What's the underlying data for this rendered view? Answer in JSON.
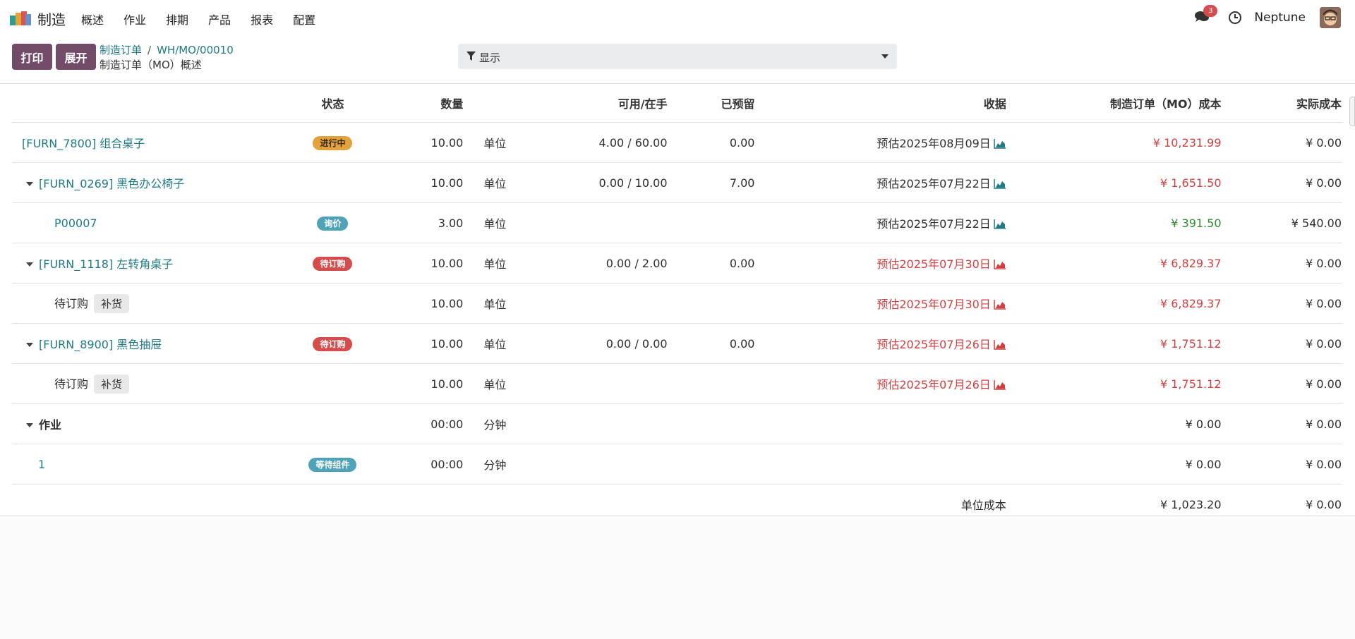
{
  "app": {
    "name": "制造"
  },
  "menu": [
    "概述",
    "作业",
    "排期",
    "产品",
    "报表",
    "配置"
  ],
  "topbar": {
    "chat_count": "3",
    "user": "Neptune"
  },
  "actions": {
    "print": "打印",
    "expand": "展开"
  },
  "breadcrumb": {
    "parent": "制造订单",
    "sep": "/",
    "current": "WH/MO/00010",
    "subtitle": "制造订单（MO）概述"
  },
  "filter": {
    "label": "显示"
  },
  "table": {
    "headers": {
      "status": "状态",
      "qty": "数量",
      "avail": "可用/在手",
      "reserved": "已预留",
      "receipt": "收据",
      "mo_cost": "制造订单（MO）成本",
      "real_cost": "实际成本"
    },
    "rows": [
      {
        "name": "[FURN_7800] 组合桌子",
        "status": "进行中",
        "qty": "10.00",
        "uom": "单位",
        "avail": "4.00 / 60.00",
        "reserved": "0.00",
        "receipt": "预估2025年08月09日",
        "mo_cost": "¥ 10,231.99",
        "real_cost": "¥ 0.00"
      },
      {
        "name": "[FURN_0269] 黑色办公椅子",
        "status": "",
        "qty": "10.00",
        "uom": "单位",
        "avail": "0.00 / 10.00",
        "reserved": "7.00",
        "receipt": "预估2025年07月22日",
        "mo_cost": "¥ 1,651.50",
        "real_cost": "¥ 0.00"
      },
      {
        "name": "P00007",
        "status": "询价",
        "qty": "3.00",
        "uom": "单位",
        "avail": "",
        "reserved": "",
        "receipt": "预估2025年07月22日",
        "mo_cost": "¥ 391.50",
        "real_cost": "¥ 540.00"
      },
      {
        "name": "[FURN_1118] 左转角桌子",
        "status": "待订购",
        "qty": "10.00",
        "uom": "单位",
        "avail": "0.00 / 2.00",
        "reserved": "0.00",
        "receipt": "预估2025年07月30日",
        "mo_cost": "¥ 6,829.37",
        "real_cost": "¥ 0.00"
      },
      {
        "name": "待订购",
        "tag": "补货",
        "status": "",
        "qty": "10.00",
        "uom": "单位",
        "avail": "",
        "reserved": "",
        "receipt": "预估2025年07月30日",
        "mo_cost": "¥ 6,829.37",
        "real_cost": "¥ 0.00"
      },
      {
        "name": "[FURN_8900] 黑色抽屉",
        "status": "待订购",
        "qty": "10.00",
        "uom": "单位",
        "avail": "0.00 / 0.00",
        "reserved": "0.00",
        "receipt": "预估2025年07月26日",
        "mo_cost": "¥ 1,751.12",
        "real_cost": "¥ 0.00"
      },
      {
        "name": "待订购",
        "tag": "补货",
        "status": "",
        "qty": "10.00",
        "uom": "单位",
        "avail": "",
        "reserved": "",
        "receipt": "预估2025年07月26日",
        "mo_cost": "¥ 1,751.12",
        "real_cost": "¥ 0.00"
      },
      {
        "name": "作业",
        "status": "",
        "qty": "00:00",
        "uom": "分钟",
        "avail": "",
        "reserved": "",
        "receipt": "",
        "mo_cost": "¥ 0.00",
        "real_cost": "¥ 0.00"
      },
      {
        "name": "1",
        "status": "等待组件",
        "qty": "00:00",
        "uom": "分钟",
        "avail": "",
        "reserved": "",
        "receipt": "",
        "mo_cost": "¥ 0.00",
        "real_cost": "¥ 0.00"
      }
    ],
    "footer": {
      "label": "单位成本",
      "mo_cost": "¥ 1,023.20",
      "real_cost": "¥ 0.00"
    }
  },
  "colors": {
    "brand": "#714b67",
    "link": "#1f7a85",
    "danger": "#d23f3f",
    "success": "#2e8b2e",
    "warning": "#e3a33c",
    "info": "#4fa3b8"
  },
  "icons": [
    "app-logo-icon",
    "chat-icon",
    "clock-icon",
    "avatar",
    "filter-icon",
    "chevron-down-icon",
    "chart-icon"
  ]
}
